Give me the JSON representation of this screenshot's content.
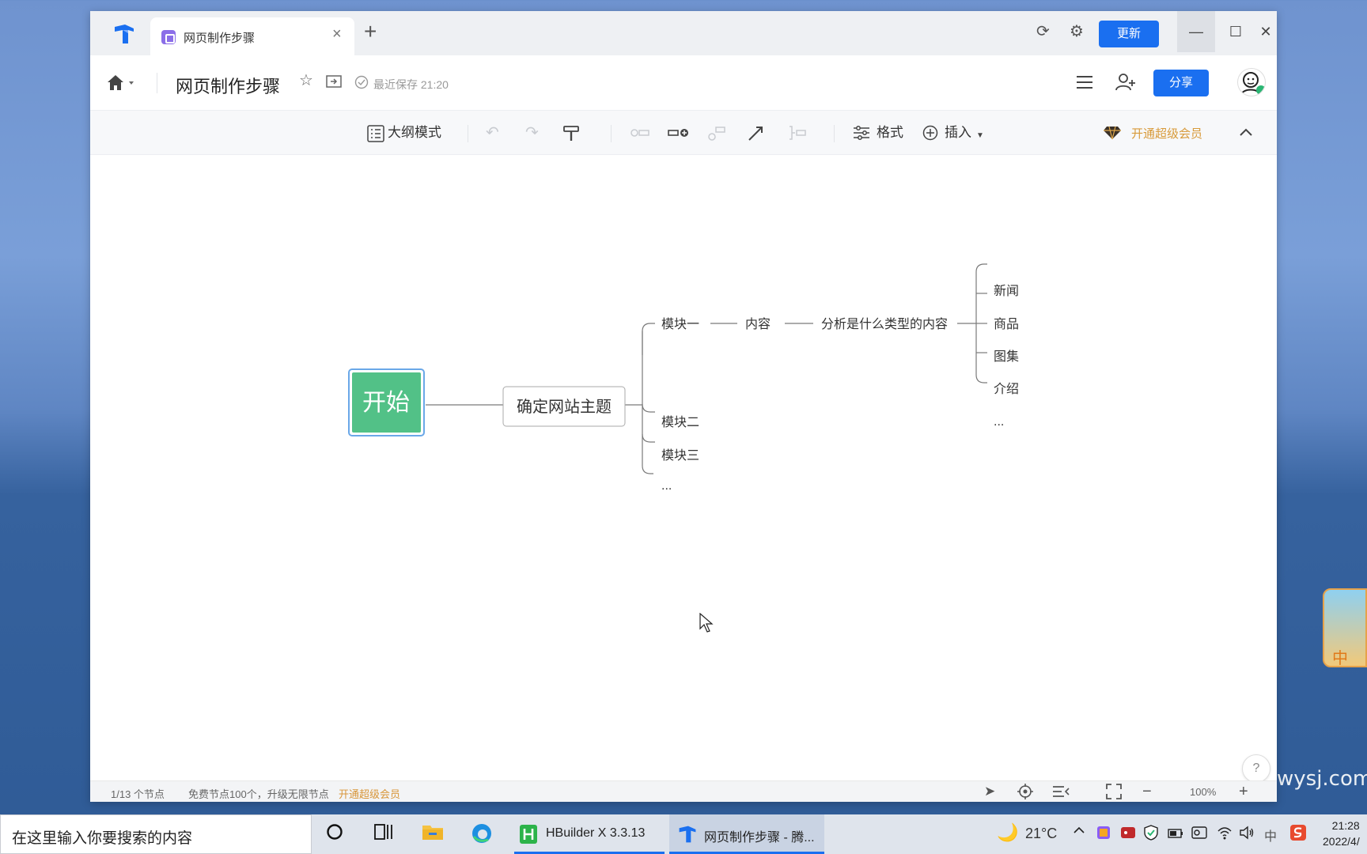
{
  "window": {
    "tab_title": "网页制作步骤",
    "update_label": "更新"
  },
  "header": {
    "doc_title": "网页制作步骤",
    "save_status": "最近保存 21:20",
    "share_label": "分享"
  },
  "toolbar": {
    "outline_label": "大纲模式",
    "format_label": "格式",
    "insert_label": "插入",
    "vip_label": "开通超级会员"
  },
  "mindmap": {
    "root": "开始",
    "topic": "确定网站主题",
    "modules": [
      "模块一",
      "模块二",
      "模块三",
      "..."
    ],
    "content": "内容",
    "analysis": "分析是什么类型的内容",
    "types": [
      "新闻",
      "商品",
      "图集",
      "介绍",
      "..."
    ]
  },
  "statusbar": {
    "node_count": "1/13 个节点",
    "free_text": "免费节点100个，升级无限节点",
    "upgrade_link": "开通超级会员",
    "zoom": "100%"
  },
  "help_label": "?",
  "taskbar": {
    "search_placeholder": "在这里输入你要搜索的内容",
    "apps": [
      {
        "label": "HBuilder X 3.3.13"
      },
      {
        "label": "网页制作步骤 - 腾..."
      }
    ],
    "weather": "21°C",
    "ime": "中",
    "time": "21:28",
    "date": "2022/4/"
  },
  "desktop": {
    "watermark": "wysj.com",
    "widget_text": "中"
  },
  "colors": {
    "accent": "#1a6ff0",
    "root_node": "#52c187",
    "vip": "#d89a3a"
  }
}
